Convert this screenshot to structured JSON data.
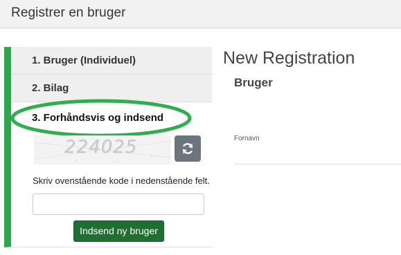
{
  "header": {
    "title": "Registrer en bruger"
  },
  "steps": [
    {
      "label": "1. Bruger (Individuel)"
    },
    {
      "label": "2. Bilag"
    },
    {
      "label": "3. Forhåndsvis og indsend"
    }
  ],
  "captcha": {
    "code": "224025",
    "refresh_icon": "refresh-icon"
  },
  "form": {
    "instruction": "Skriv ovenstående kode i nedenstående felt.",
    "code_value": "",
    "submit_label": "Indsend ny bruger"
  },
  "main": {
    "title": "New Registration",
    "section_title": "Bruger",
    "fields": [
      {
        "label": "Fornavn",
        "value": ""
      }
    ]
  },
  "colors": {
    "accent_green": "#2aa84a",
    "submit_green": "#1f6f31",
    "annotation_green": "#2fae4e",
    "refresh_gray": "#6c757d"
  }
}
